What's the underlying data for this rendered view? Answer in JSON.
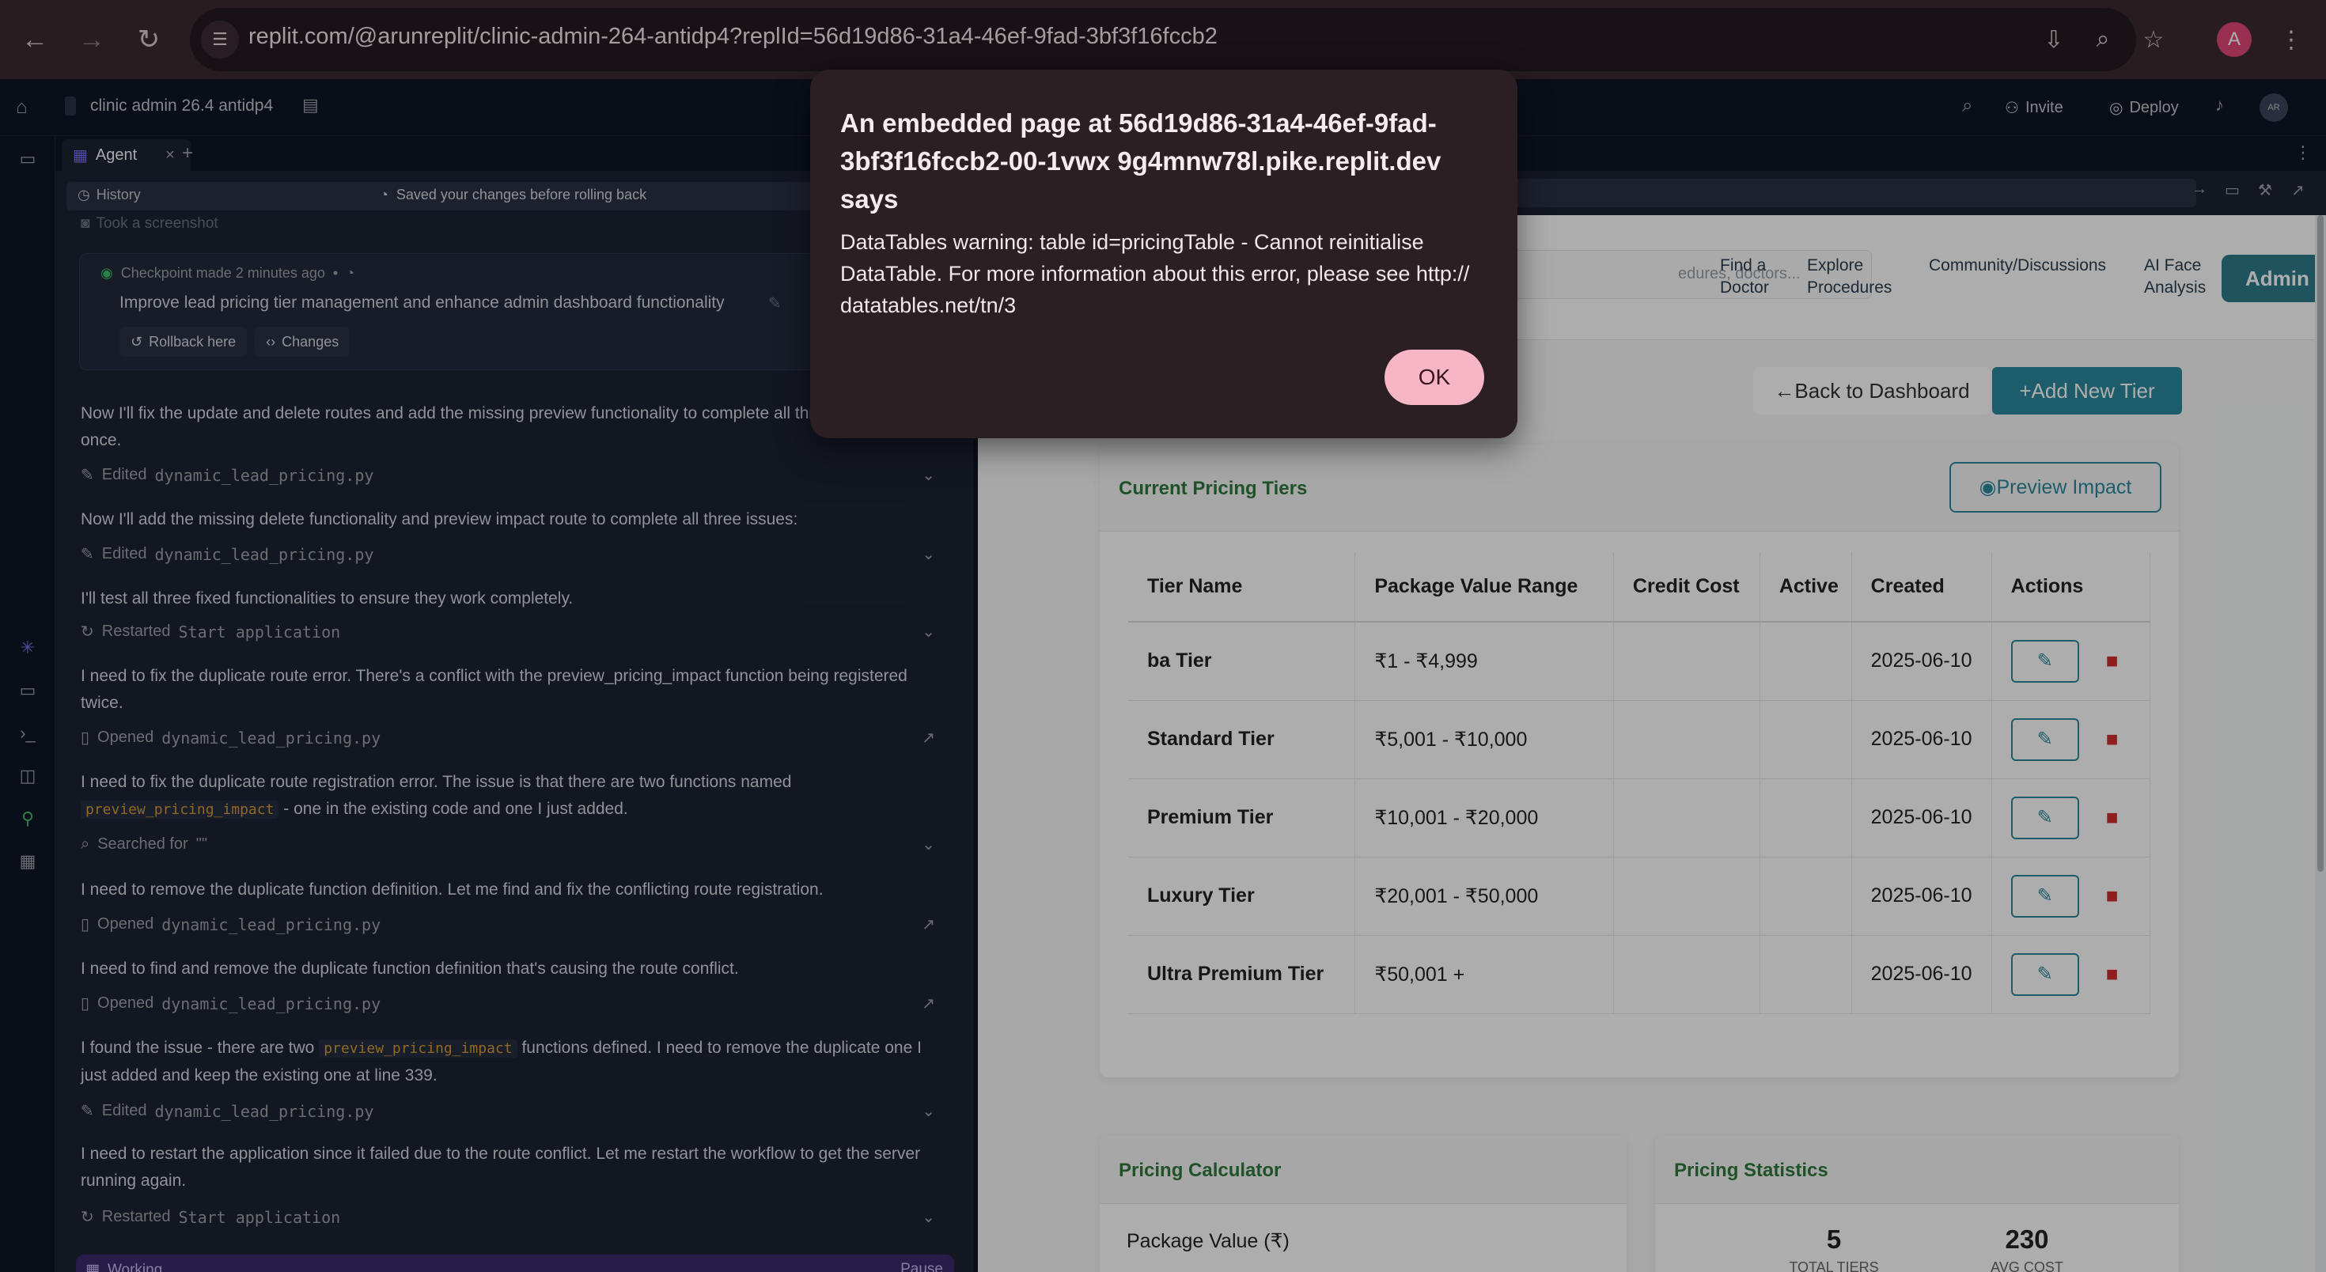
{
  "browser": {
    "url": "replit.com/@arunreplit/clinic-admin-264-antidp4?replId=56d19d86-31a4-46ef-9fad-3bf3f16fccb2",
    "profile_initial": "A"
  },
  "replit": {
    "project_name": "clinic admin 26.4 antidp4",
    "invite_label": "Invite",
    "deploy_label": "Deploy",
    "avatar_initials": "AR"
  },
  "agent": {
    "tab_label": "Agent",
    "history_label": "History",
    "saved_notice": "Saved your changes before rolling back",
    "truncated_top": "Took a screenshot",
    "checkpoint": {
      "meta": "Checkpoint made 2 minutes ago",
      "title": "Improve lead pricing tier management and enhance admin dashboard functionality",
      "rollback_label": "Rollback here",
      "changes_label": "Changes"
    },
    "messages": [
      {
        "text": "Now I'll fix the update and delete routes and add the missing preview functionality to complete all three issues at once."
      },
      {
        "tool": "Edited",
        "file": "dynamic_lead_pricing.py"
      },
      {
        "text": "Now I'll add the missing delete functionality and preview impact route to complete all three issues:"
      },
      {
        "tool": "Edited",
        "file": "dynamic_lead_pricing.py"
      },
      {
        "text": "I'll test all three fixed functionalities to ensure they work completely."
      },
      {
        "tool": "Restarted",
        "file": "Start application"
      },
      {
        "text": "I need to fix the duplicate route error. There's a conflict with the preview_pricing_impact function being registered twice."
      },
      {
        "tool": "Opened",
        "file": "dynamic_lead_pricing.py"
      },
      {
        "text_a": "I need to fix the duplicate route registration error. The issue is that there are two functions named",
        "code": "preview_pricing_impact",
        "text_b": "- one in the existing code and one I just added."
      },
      {
        "tool": "Searched for",
        "file": "\"\""
      },
      {
        "text": "I need to remove the duplicate function definition. Let me find and fix the conflicting route registration."
      },
      {
        "tool": "Opened",
        "file": "dynamic_lead_pricing.py"
      },
      {
        "text": "I need to find and remove the duplicate function definition that's causing the route conflict."
      },
      {
        "tool": "Opened",
        "file": "dynamic_lead_pricing.py"
      },
      {
        "text_a": "I found the issue - there are two",
        "code": "preview_pricing_impact",
        "text_b": "functions defined. I need to remove the duplicate one I just added and keep the existing one at line 339."
      },
      {
        "tool": "Edited",
        "file": "dynamic_lead_pricing.py"
      },
      {
        "text": "I need to restart the application since it failed due to the route conflict. Let me restart the workflow to get the server running again."
      },
      {
        "tool": "Restarted",
        "file": "Start application"
      }
    ],
    "working_label": "Working",
    "pause_label": "Pause"
  },
  "site": {
    "search_placeholder": "edures, doctors...",
    "nav": {
      "find_doctor": "Find a Doctor",
      "explore": "Explore Procedures",
      "community": "Community/Discussions",
      "ai_face": "AI Face Analysis",
      "admin": "Admin"
    },
    "back_label": "Back to Dashboard",
    "add_label": "Add New Tier",
    "tiers_card": {
      "title": "Current Pricing Tiers",
      "preview_label": "Preview Impact",
      "columns": [
        "Tier Name",
        "Package Value Range",
        "Credit Cost",
        "Active",
        "Created",
        "Actions"
      ],
      "rows": [
        {
          "name": "ba Tier",
          "range": "₹1 - ₹4,999",
          "credit": "",
          "active": "",
          "created": "2025-06-10"
        },
        {
          "name": "Standard Tier",
          "range": "₹5,001 - ₹10,000",
          "credit": "",
          "active": "",
          "created": "2025-06-10"
        },
        {
          "name": "Premium Tier",
          "range": "₹10,001 - ₹20,000",
          "credit": "",
          "active": "",
          "created": "2025-06-10"
        },
        {
          "name": "Luxury Tier",
          "range": "₹20,001 - ₹50,000",
          "credit": "",
          "active": "",
          "created": "2025-06-10"
        },
        {
          "name": "Ultra Premium Tier",
          "range": "₹50,001 +",
          "credit": "",
          "active": "",
          "created": "2025-06-10"
        }
      ]
    },
    "calculator": {
      "title": "Pricing Calculator",
      "field_label": "Package Value (₹)"
    },
    "statistics": {
      "title": "Pricing Statistics",
      "total_tiers": "5",
      "total_tiers_label": "TOTAL TIERS",
      "avg_cost": "230",
      "avg_cost_label": "AVG COST"
    }
  },
  "dialog": {
    "title": "An embedded page at 56d19d86-31a4-46ef-9fad-3bf3f16fccb2-00-1vwx 9g4mnw78l.pike.replit.dev says",
    "body": "DataTables warning: table id=pricingTable - Cannot reinitialise DataTable. For more information about this error, please see http:// datatables.net/tn/3",
    "ok_label": "OK"
  },
  "colors": {
    "dialog_bg": "#2b1f24",
    "ok_button": "#f7b6c6",
    "accent_teal": "#2b8a9e",
    "card_title_green": "#2f7a3c",
    "delete_red": "#d32f2f"
  }
}
